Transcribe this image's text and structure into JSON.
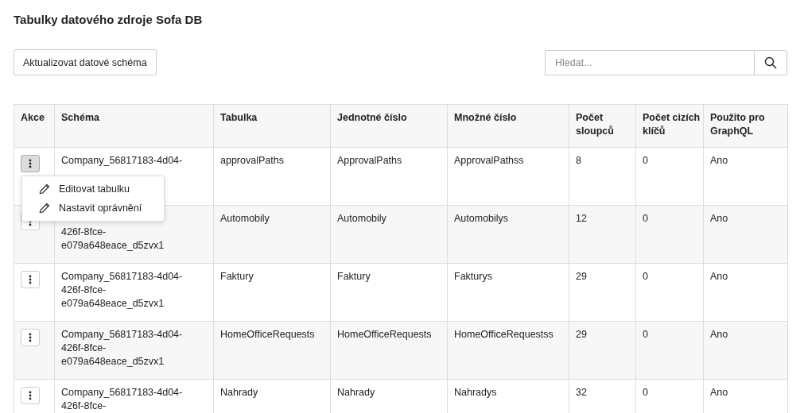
{
  "title": "Tabulky datového zdroje Sofa DB",
  "refresh_button": "Aktualizovat datové schéma",
  "search": {
    "placeholder": "Hledat..."
  },
  "table": {
    "action_column": "Akce",
    "columns": [
      "Schéma",
      "Tabulka",
      "Jednotné číslo",
      "Množné číslo",
      "Počet sloupců",
      "Počet cizích klíčů",
      "Použito pro GraphQL"
    ],
    "rows": [
      {
        "menu_open": true,
        "cells": [
          "Company_56817183-4d04-",
          "approvalPaths",
          "ApprovalPaths",
          "ApprovalPathss",
          "8",
          "0",
          "Ano"
        ]
      },
      {
        "menu_open": false,
        "cells": [
          "426f-8fce-e079a648eace_d5zvx1",
          "Automobily",
          "Automobily",
          "Automobilys",
          "12",
          "0",
          "Ano"
        ]
      },
      {
        "menu_open": false,
        "cells": [
          "Company_56817183-4d04-426f-8fce-e079a648eace_d5zvx1",
          "Faktury",
          "Faktury",
          "Fakturys",
          "29",
          "0",
          "Ano"
        ]
      },
      {
        "menu_open": false,
        "cells": [
          "Company_56817183-4d04-426f-8fce-e079a648eace_d5zvx1",
          "HomeOfficeRequests",
          "HomeOfficeRequests",
          "HomeOfficeRequestss",
          "29",
          "0",
          "Ano"
        ]
      },
      {
        "menu_open": false,
        "cells": [
          "Company_56817183-4d04-426f-8fce-",
          "Nahrady",
          "Nahrady",
          "Nahradys",
          "32",
          "0",
          "Ano"
        ]
      }
    ]
  },
  "action_menu": {
    "items": [
      "Editovat tabulku",
      "Nastavit oprávnění"
    ]
  }
}
